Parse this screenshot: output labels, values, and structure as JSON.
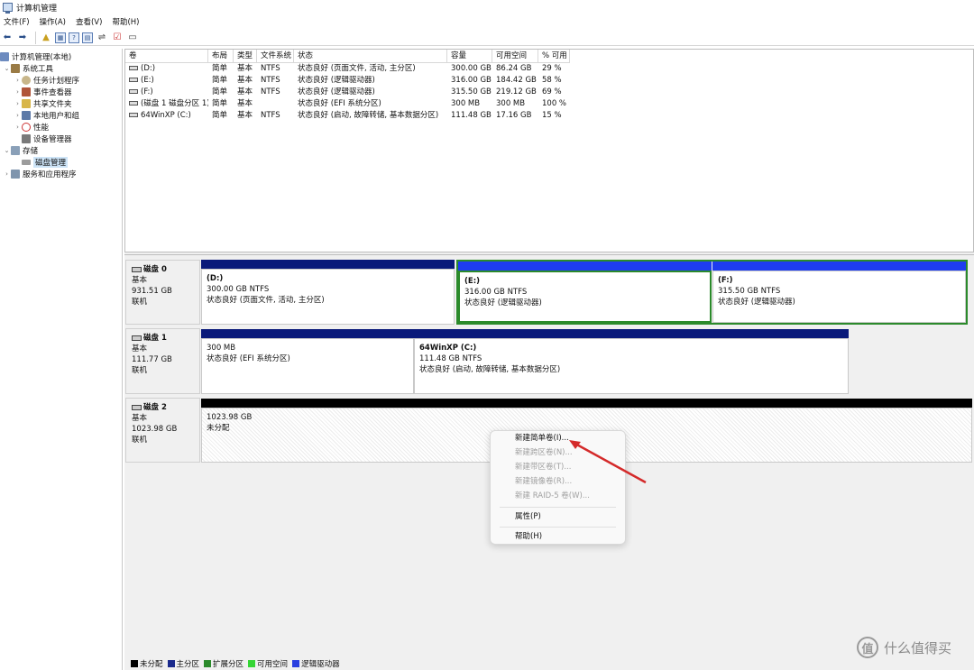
{
  "window": {
    "title": "计算机管理"
  },
  "menu": [
    "文件(F)",
    "操作(A)",
    "查看(V)",
    "帮助(H)"
  ],
  "toolbar": {
    "icons": [
      "back-arrow-icon",
      "forward-arrow-icon",
      "folder-up-icon",
      "show-tree-icon",
      "help-icon",
      "properties-icon",
      "connect-icon",
      "check-icon",
      "view-icon"
    ]
  },
  "tree": {
    "root": "计算机管理(本地)",
    "system_tools": "系统工具",
    "task_scheduler": "任务计划程序",
    "event_viewer": "事件查看器",
    "shared_folders": "共享文件夹",
    "local_users": "本地用户和组",
    "performance": "性能",
    "device_manager": "设备管理器",
    "storage": "存储",
    "disk_management": "磁盘管理",
    "services_apps": "服务和应用程序"
  },
  "volumes": {
    "headers": [
      "卷",
      "布局",
      "类型",
      "文件系统",
      "状态",
      "容量",
      "可用空间",
      "% 可用"
    ],
    "rows": [
      [
        "(D:)",
        "简单",
        "基本",
        "NTFS",
        "状态良好 (页面文件, 活动, 主分区)",
        "300.00 GB",
        "86.24 GB",
        "29 %"
      ],
      [
        "(E:)",
        "简单",
        "基本",
        "NTFS",
        "状态良好 (逻辑驱动器)",
        "316.00 GB",
        "184.42 GB",
        "58 %"
      ],
      [
        "(F:)",
        "简单",
        "基本",
        "NTFS",
        "状态良好 (逻辑驱动器)",
        "315.50 GB",
        "219.12 GB",
        "69 %"
      ],
      [
        "(磁盘 1 磁盘分区 1)",
        "简单",
        "基本",
        "",
        "状态良好 (EFI 系统分区)",
        "300 MB",
        "300 MB",
        "100 %"
      ],
      [
        "64WinXP  (C:)",
        "简单",
        "基本",
        "NTFS",
        "状态良好 (启动, 故障转储, 基本数据分区)",
        "111.48 GB",
        "17.16 GB",
        "15 %"
      ]
    ]
  },
  "disks": [
    {
      "name": "磁盘 0",
      "type": "基本",
      "size": "931.51 GB",
      "status": "联机",
      "partitions": [
        {
          "name": "(D:)",
          "size": "300.00 GB NTFS",
          "status": "状态良好 (页面文件, 活动, 主分区)"
        },
        {
          "name": "(E:)",
          "size": "316.00 GB NTFS",
          "status": "状态良好 (逻辑驱动器)"
        },
        {
          "name": "(F:)",
          "size": "315.50 GB NTFS",
          "status": "状态良好 (逻辑驱动器)"
        }
      ]
    },
    {
      "name": "磁盘 1",
      "type": "基本",
      "size": "111.77 GB",
      "status": "联机",
      "partitions": [
        {
          "name": "",
          "size": "300 MB",
          "status": "状态良好 (EFI 系统分区)"
        },
        {
          "name": "64WinXP   (C:)",
          "size": "111.48 GB NTFS",
          "status": "状态良好 (启动, 故障转储, 基本数据分区)"
        }
      ]
    },
    {
      "name": "磁盘 2",
      "type": "基本",
      "size": "1023.98 GB",
      "status": "联机",
      "partitions": [
        {
          "name": "",
          "size": "1023.98 GB",
          "status": "未分配"
        }
      ]
    }
  ],
  "context_menu": {
    "new_simple": "新建简单卷(I)...",
    "new_spanned": "新建跨区卷(N)...",
    "new_striped": "新建带区卷(T)...",
    "new_mirror": "新建镜像卷(R)...",
    "new_raid5": "新建 RAID-5 卷(W)...",
    "properties": "属性(P)",
    "help": "帮助(H)"
  },
  "legend": [
    {
      "label": "未分配",
      "color": "#000000"
    },
    {
      "label": "主分区",
      "color": "#1a2a8c"
    },
    {
      "label": "扩展分区",
      "color": "#2b8a2b"
    },
    {
      "label": "可用空间",
      "color": "#35d535"
    },
    {
      "label": "逻辑驱动器",
      "color": "#2a3fe0"
    }
  ],
  "colors": {
    "primary_bar": "#0a1a7a",
    "logical_bar": "#1e3cf0",
    "unallocated_bar": "#000000",
    "extended_border": "#2b8a2b",
    "arrow": "#d42a2a"
  },
  "watermark": {
    "text": "什么值得买",
    "logo": "值"
  }
}
